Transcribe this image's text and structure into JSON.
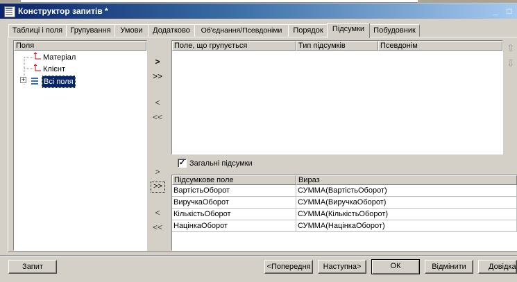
{
  "window": {
    "title": "Конструктор запитів *",
    "minimize": "_",
    "maximize": "□"
  },
  "tabs": [
    {
      "label": "Таблиці і поля"
    },
    {
      "label": "Групування"
    },
    {
      "label": "Умови"
    },
    {
      "label": "Додатково"
    },
    {
      "label": "Об'єднання/Псевдоніми"
    },
    {
      "label": "Порядок"
    },
    {
      "label": "Підсумки",
      "active": true
    },
    {
      "label": "Побудовник"
    }
  ],
  "fields_panel": {
    "header": "Поля",
    "items": [
      {
        "label": "Матеріал"
      },
      {
        "label": "Клієнт"
      },
      {
        "label": "Всі поля",
        "selected": true,
        "expand": "+"
      }
    ]
  },
  "move_buttons_top": [
    ">",
    ">>",
    "<",
    "<<"
  ],
  "move_buttons_bottom": [
    ">",
    ">>",
    "<",
    "<<"
  ],
  "grouping_table": {
    "columns": [
      "Поле, що групується",
      "Тип підсумків",
      "Псевдонім"
    ]
  },
  "overall_totals": {
    "label": "Загальні підсумки",
    "checked": true,
    "mark": "✓"
  },
  "totals_table": {
    "columns": [
      "Підсумкове поле",
      "Вираз"
    ],
    "rows": [
      {
        "field": "ВартістьОборот",
        "expr": "СУММА(ВартістьОборот)"
      },
      {
        "field": "ВиручкаОборот",
        "expr": "СУММА(ВиручкаОборот)"
      },
      {
        "field": "КількістьОборот",
        "expr": "СУММА(КількістьОборот)"
      },
      {
        "field": "НацінкаОборот",
        "expr": "СУММА(НацінкаОборот)"
      }
    ]
  },
  "footer": {
    "query": "Запит",
    "previous": "<Попередня",
    "next": "Наступна>",
    "ok": "ОК",
    "cancel": "Відмінити",
    "help": "Довідка"
  },
  "side_arrows": {
    "up": "⇧",
    "down": "⇩"
  },
  "colors": {
    "title_start": "#0a246a",
    "title_end": "#a6caf0",
    "selection": "#0a246a",
    "face": "#d4d0c8"
  }
}
